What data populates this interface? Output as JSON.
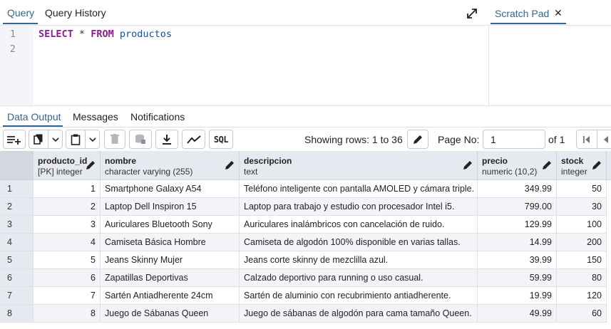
{
  "query_tabs": {
    "query": "Query",
    "history": "Query History"
  },
  "scratch": {
    "label": "Scratch Pad",
    "close": "✕"
  },
  "editor": {
    "line_numbers": [
      "1",
      "2"
    ],
    "kw_select": "SELECT",
    "star": "*",
    "kw_from": "FROM",
    "table": "productos"
  },
  "output_tabs": {
    "data_output": "Data Output",
    "messages": "Messages",
    "notifications": "Notifications"
  },
  "toolbar": {
    "rows_info": "Showing rows: 1 to 36",
    "page_label": "Page No:",
    "page_value": "1",
    "of_label": "of 1",
    "sql_label": "SQL"
  },
  "columns": [
    {
      "name": "producto_id",
      "type": "[PK] integer"
    },
    {
      "name": "nombre",
      "type": "character varying (255)"
    },
    {
      "name": "descripcion",
      "type": "text"
    },
    {
      "name": "precio",
      "type": "numeric (10,2)"
    },
    {
      "name": "stock",
      "type": "integer"
    }
  ],
  "rows": [
    {
      "n": "1",
      "id": "1",
      "nombre": "Smartphone Galaxy A54",
      "descripcion": "Teléfono inteligente con pantalla AMOLED y cámara triple.",
      "precio": "349.99",
      "stock": "50"
    },
    {
      "n": "2",
      "id": "2",
      "nombre": "Laptop Dell Inspiron 15",
      "descripcion": "Laptop para trabajo y estudio con procesador Intel i5.",
      "precio": "799.00",
      "stock": "30"
    },
    {
      "n": "3",
      "id": "3",
      "nombre": "Auriculares Bluetooth Sony",
      "descripcion": "Auriculares inalámbricos con cancelación de ruido.",
      "precio": "129.99",
      "stock": "100"
    },
    {
      "n": "4",
      "id": "4",
      "nombre": "Camiseta Básica Hombre",
      "descripcion": "Camiseta de algodón 100% disponible en varias tallas.",
      "precio": "14.99",
      "stock": "200"
    },
    {
      "n": "5",
      "id": "5",
      "nombre": "Jeans Skinny Mujer",
      "descripcion": "Jeans corte skinny de mezclilla azul.",
      "precio": "39.99",
      "stock": "150"
    },
    {
      "n": "6",
      "id": "6",
      "nombre": "Zapatillas Deportivas",
      "descripcion": "Calzado deportivo para running o uso casual.",
      "precio": "59.99",
      "stock": "80"
    },
    {
      "n": "7",
      "id": "7",
      "nombre": "Sartén Antiadherente 24cm",
      "descripcion": "Sartén de aluminio con recubrimiento antiadherente.",
      "precio": "19.99",
      "stock": "120"
    },
    {
      "n": "8",
      "id": "8",
      "nombre": "Juego de Sábanas Queen",
      "descripcion": "Juego de sábanas de algodón para cama tamaño Queen.",
      "precio": "49.99",
      "stock": "60"
    }
  ],
  "colors": {
    "accent": "#326690",
    "header_bg": "#e6e9ef",
    "keyword": "#8a1f8f",
    "identifier": "#1a4f9c"
  }
}
